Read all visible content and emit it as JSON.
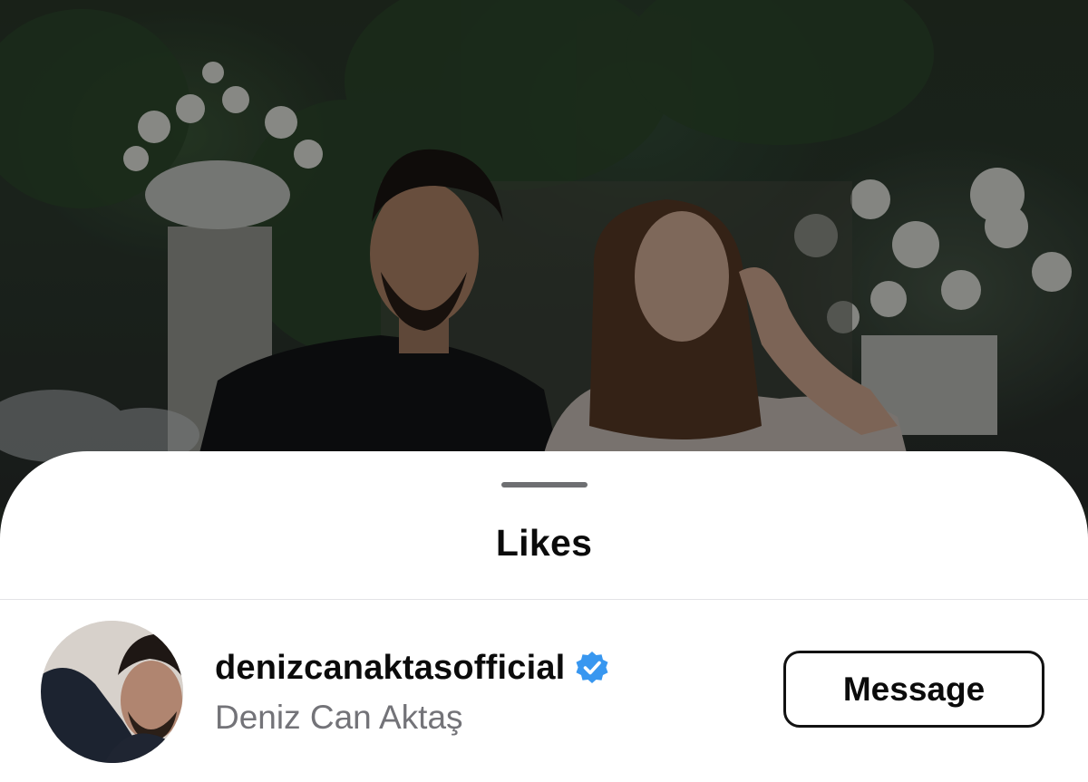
{
  "sheet": {
    "title": "Likes"
  },
  "likes": [
    {
      "username": "denizcanaktasofficial",
      "full_name": "Deniz Can Aktaş",
      "verified": true,
      "action_label": "Message",
      "avatar_icon": "profile-photo"
    }
  ],
  "colors": {
    "verified_badge": "#3897f0",
    "secondary_text": "#737378",
    "sheet_background": "#ffffff"
  }
}
